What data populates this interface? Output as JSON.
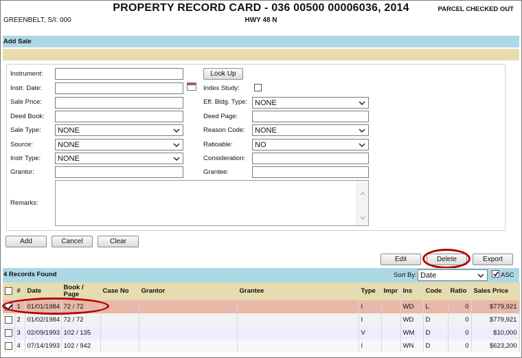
{
  "header": {
    "owner": "GREENBELT, S/I: 000",
    "title": "PROPERTY RECORD CARD - 036 00500 00006036, 2014",
    "road": "HWY 48 N",
    "status": "PARCEL CHECKED OUT"
  },
  "section_title": "Add Sale",
  "form": {
    "instrument_label": "Instrument:",
    "lookup_button": "Look Up",
    "instr_date_label": "Instr. Date:",
    "index_study_label": "Index Study:",
    "sale_price_label": "Sale Price:",
    "eff_bldg_type_label": "Eff. Bldg. Type:",
    "eff_bldg_type_value": "NONE",
    "deed_book_label": "Deed Book:",
    "deed_page_label": "Deed Page:",
    "sale_type_label": "Sale Type:",
    "sale_type_value": "NONE",
    "reason_code_label": "Reason Code:",
    "reason_code_value": "NONE",
    "source_label": "Source:",
    "source_value": "NONE",
    "ratioable_label": "Ratioable:",
    "ratioable_value": "NO",
    "instr_type_label": "Instr Type:",
    "instr_type_value": "NONE",
    "consideration_label": "Consideration:",
    "grantor_label": "Grantor:",
    "grantee_label": "Grantee:",
    "remarks_label": "Remarks:"
  },
  "form_buttons": {
    "add": "Add",
    "cancel": "Cancel",
    "clear": "Clear"
  },
  "record_buttons": {
    "edit": "Edit",
    "delete": "Delete",
    "export": "Export"
  },
  "records": {
    "found": "4 Records Found",
    "sort_by_label": "Sort By:",
    "sort_by_value": "Date",
    "asc_label": "ASC"
  },
  "table": {
    "headers": [
      "#",
      "Date",
      "Book / Page",
      "Case No",
      "Grantor",
      "Grantee",
      "Type",
      "Impr",
      "Ins",
      "Code",
      "Ratio",
      "Sales Price"
    ],
    "rows": [
      {
        "num": "1",
        "date": "01/01/1984",
        "book": "72 / 72",
        "case": "",
        "grantor": "",
        "grantee": "",
        "type": "I",
        "impr": "",
        "ins": "WD",
        "code": "L",
        "ratio": "0",
        "price": "$779,921",
        "checked": true
      },
      {
        "num": "2",
        "date": "01/02/1984",
        "book": "72 / 72",
        "case": "",
        "grantor": "",
        "grantee": "",
        "type": "I",
        "impr": "",
        "ins": "WD",
        "code": "D",
        "ratio": "0",
        "price": "$779,921",
        "checked": false
      },
      {
        "num": "3",
        "date": "02/09/1993",
        "book": "102 / 135",
        "case": "",
        "grantor": "",
        "grantee": "",
        "type": "V",
        "impr": "",
        "ins": "WM",
        "code": "D",
        "ratio": "0",
        "price": "$10,000",
        "checked": false
      },
      {
        "num": "4",
        "date": "07/14/1993",
        "book": "102 / 942",
        "case": "",
        "grantor": "",
        "grantee": "",
        "type": "I",
        "impr": "",
        "ins": "WN",
        "code": "D",
        "ratio": "0",
        "price": "$623,200",
        "checked": false
      }
    ]
  },
  "colors": {
    "section_bar": "#add8e6",
    "tan_bar": "#e6dcb0",
    "selected_row": "#e8b8a8",
    "annotation": "#b00000"
  }
}
